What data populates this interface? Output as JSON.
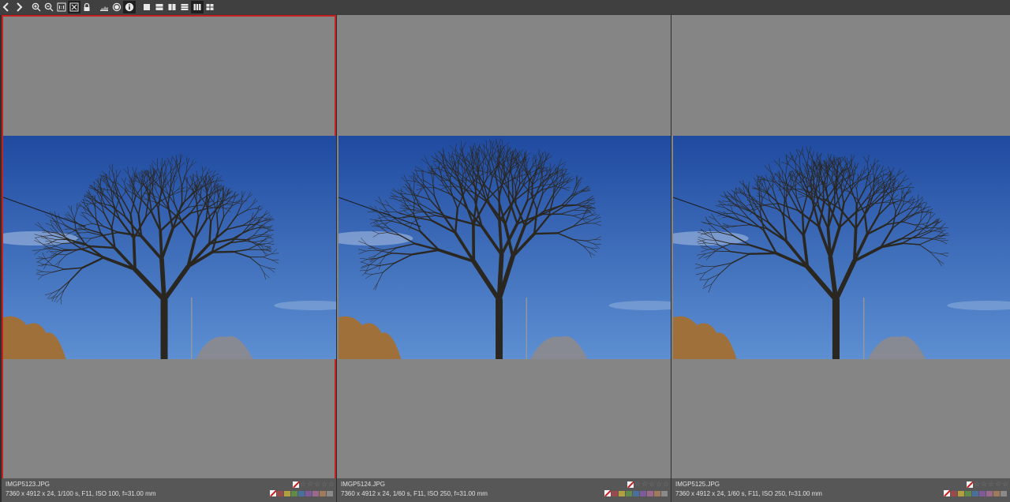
{
  "toolbar": {
    "buttons": [
      {
        "name": "previous-button",
        "icon": "chevron-left-icon"
      },
      {
        "name": "next-button",
        "icon": "chevron-right-icon"
      },
      {
        "name": "zoom-in-button",
        "icon": "zoom-in-icon"
      },
      {
        "name": "zoom-out-button",
        "icon": "zoom-out-icon"
      },
      {
        "name": "zoom-100-button",
        "icon": "one-to-one-icon"
      },
      {
        "name": "zoom-fit-button",
        "icon": "fit-screen-icon",
        "active": true
      },
      {
        "name": "lock-button",
        "icon": "lock-icon"
      },
      {
        "name": "histogram-button",
        "icon": "histogram-icon"
      },
      {
        "name": "focus-mask-button",
        "icon": "circle-icon"
      },
      {
        "name": "info-button",
        "icon": "info-icon",
        "active": true
      },
      {
        "name": "layout-single-button",
        "icon": "layout-single-icon"
      },
      {
        "name": "layout-two-rows-button",
        "icon": "layout-rows-icon"
      },
      {
        "name": "layout-two-columns-button",
        "icon": "layout-columns-icon"
      },
      {
        "name": "layout-three-rows-button",
        "icon": "layout-three-rows-icon"
      },
      {
        "name": "layout-three-columns-button",
        "icon": "layout-three-columns-icon",
        "active": true
      },
      {
        "name": "layout-grid-button",
        "icon": "layout-grid-icon"
      }
    ]
  },
  "images": [
    {
      "filename": "IMGP5123.JPG",
      "meta": "7360 x 4912 x 24, 1/100 s, F11, ISO 100, f=31.00 mm",
      "selected": true,
      "rating": 0
    },
    {
      "filename": "IMGP5124.JPG",
      "meta": "7360 x 4912 x 24, 1/60 s, F11, ISO 250, f=31.00 mm",
      "selected": false,
      "rating": 0
    },
    {
      "filename": "IMGP5125.JPG",
      "meta": "7360 x 4912 x 24, 1/60 s, F11, ISO 250, f=31.00 mm",
      "selected": false,
      "rating": 0
    }
  ],
  "colors": {
    "background": "#858585",
    "selection": "#c62020",
    "info_bar": "#575757",
    "sky_top": "#1f4aa0",
    "sky_bottom": "#5d8fd2",
    "color_labels": [
      "#9a4a4a",
      "#b0a040",
      "#5f8a4a",
      "#4a6f9a",
      "#7e5a9a",
      "#9a6a8a",
      "#a07a5a",
      "#8a8a8a"
    ]
  }
}
